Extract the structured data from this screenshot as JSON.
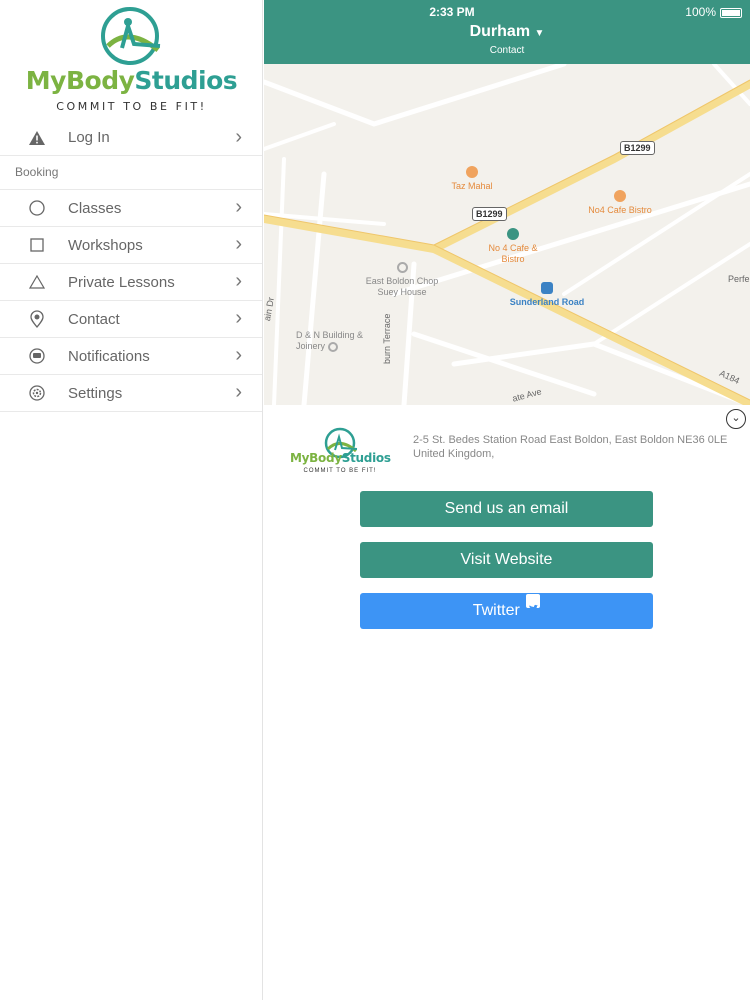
{
  "status": {
    "time": "2:33 PM",
    "battery": "100%"
  },
  "brand": {
    "name_part1": "MyBody",
    "name_part2": "Studios",
    "tagline": "COMMIT TO BE FIT!"
  },
  "sidebar": {
    "login": "Log In",
    "section_booking": "Booking",
    "items": [
      {
        "label": "Classes",
        "icon": "circle-icon"
      },
      {
        "label": "Workshops",
        "icon": "square-icon"
      },
      {
        "label": "Private Lessons",
        "icon": "triangle-icon"
      },
      {
        "label": "Contact",
        "icon": "location-pin-icon"
      },
      {
        "label": "Notifications",
        "icon": "chat-bubble-icon"
      },
      {
        "label": "Settings",
        "icon": "gear-icon"
      }
    ]
  },
  "header": {
    "title": "Durham",
    "dropdown": "▼",
    "subtitle": "Contact"
  },
  "map": {
    "pois": [
      {
        "name": "Taz Mahal"
      },
      {
        "name": "No4 Cafe Bistro"
      },
      {
        "name": "No 4 Cafe & Bistro"
      },
      {
        "name": "East Boldon Chop Suey House"
      },
      {
        "name": "D & N Building & Joinery"
      },
      {
        "name": "Sunderland Road"
      }
    ],
    "road_badges": [
      "B1299",
      "B1299"
    ],
    "road_labels": [
      "A184",
      "Perfe",
      "burn Terrace",
      "ain Dr",
      "ate Ave"
    ]
  },
  "contact": {
    "address": "2-5 St. Bedes Station Road East Boldon, East Boldon NE36 0LE United Kingdom,",
    "email_button": "Send us an email",
    "website_button": "Visit Website",
    "twitter_button": "Twitter"
  },
  "colors": {
    "primary": "#3b9482",
    "twitter": "#3d94f5",
    "brand_green": "#7cb342",
    "brand_teal": "#2e9f93"
  }
}
